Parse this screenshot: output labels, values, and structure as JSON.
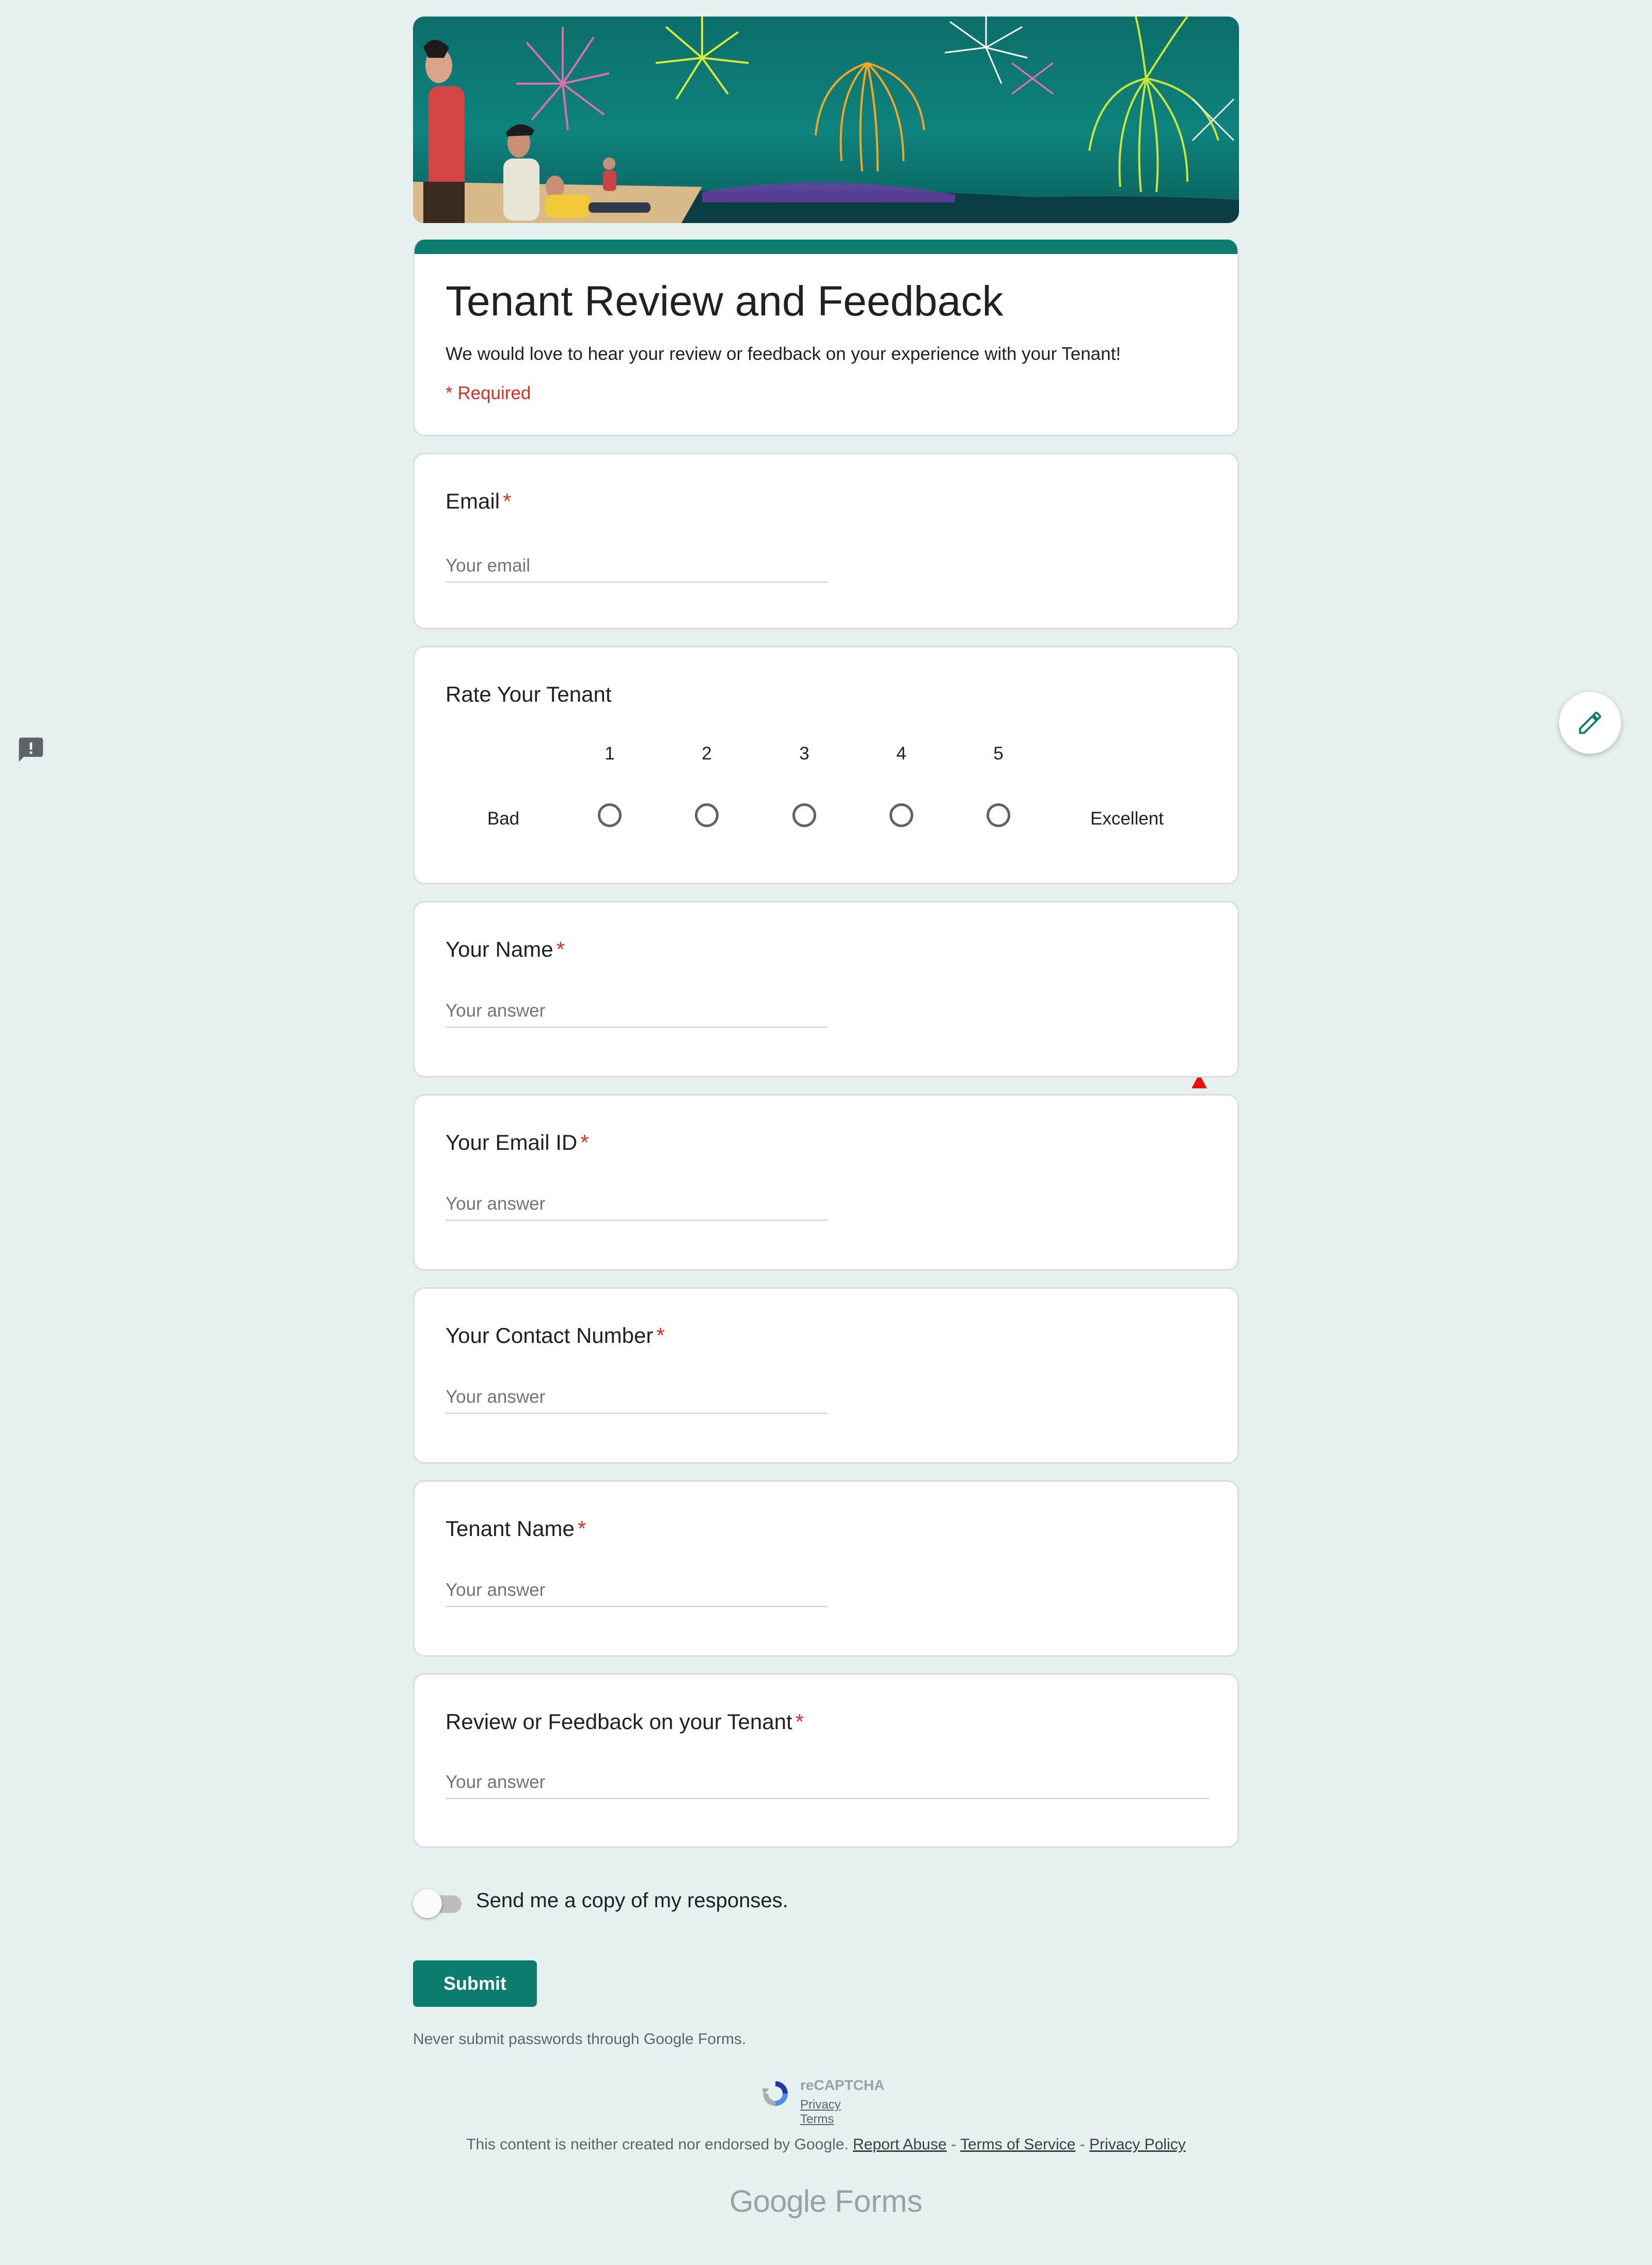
{
  "form": {
    "title": "Tenant Review and Feedback",
    "description": "We would love to hear your review or feedback on your experience with your Tenant!",
    "required_note": "* Required"
  },
  "questions": {
    "email": {
      "label": "Email",
      "placeholder": "Your email",
      "required": "*"
    },
    "rating": {
      "label": "Rate Your Tenant",
      "scale": [
        "1",
        "2",
        "3",
        "4",
        "5"
      ],
      "low_label": "Bad",
      "high_label": "Excellent"
    },
    "your_name": {
      "label": "Your Name",
      "placeholder": "Your answer",
      "required": "*"
    },
    "your_email_id": {
      "label": "Your Email ID",
      "placeholder": "Your answer",
      "required": "*"
    },
    "contact_number": {
      "label": "Your Contact Number",
      "placeholder": "Your answer",
      "required": "*"
    },
    "tenant_name": {
      "label": "Tenant Name",
      "placeholder": "Your answer",
      "required": "*"
    },
    "review": {
      "label": "Review or Feedback on your Tenant",
      "placeholder": "Your answer",
      "required": "*"
    }
  },
  "send_copy": {
    "label": "Send me a copy of my responses.",
    "enabled": false
  },
  "submit": {
    "label": "Submit"
  },
  "password_note": "Never submit passwords through Google Forms.",
  "recaptcha": {
    "title": "reCAPTCHA",
    "privacy": "Privacy",
    "terms": "Terms"
  },
  "footer": {
    "text": "This content is neither created nor endorsed by Google.",
    "report_abuse": "Report Abuse",
    "separator": "-",
    "terms_of_service": "Terms of Service",
    "privacy_policy": "Privacy Policy"
  },
  "brand": {
    "google": "Google",
    "forms": "Forms"
  },
  "colors": {
    "accent": "#0c7c6f",
    "background": "#e6f0ef",
    "required": "#d93025"
  }
}
